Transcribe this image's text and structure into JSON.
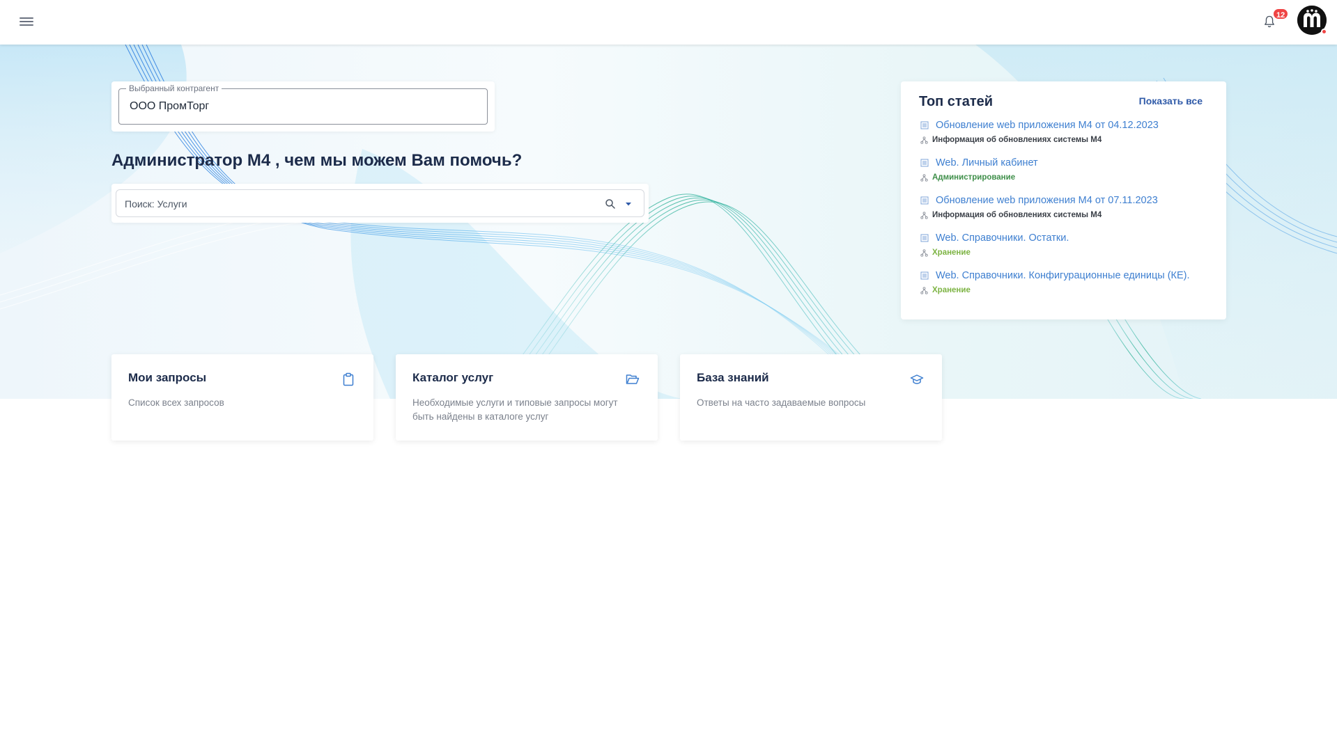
{
  "header": {
    "menu_icon": "hamburger-menu-icon",
    "notifications_icon": "bell-icon",
    "notifications_count": "12",
    "avatar_icon": "m4-logo-avatar"
  },
  "counterparty": {
    "label": "Выбранный контрагент",
    "value": "ООО ПромТорг"
  },
  "greeting": "Администратор М4 , чем мы можем Вам помочь?",
  "search": {
    "placeholder": "Поиск: Услуги",
    "search_icon": "search-icon",
    "dropdown_icon": "caret-down-icon"
  },
  "top_articles": {
    "title": "Топ статей",
    "show_all": "Показать все",
    "items": [
      {
        "title": "Обновление web приложения М4 от 04.12.2023",
        "category": "Информация об обновлениях системы М4",
        "category_color": "#3a3f47"
      },
      {
        "title": "Web. Личный кабинет",
        "category": "Администрирование",
        "category_color": "#3f8f4a"
      },
      {
        "title": "Обновление web приложения М4 от 07.11.2023",
        "category": "Информация об обновлениях системы М4",
        "category_color": "#3a3f47"
      },
      {
        "title": "Web. Справочники. Остатки.",
        "category": "Хранение",
        "category_color": "#7cb342"
      },
      {
        "title": "Web. Справочники. Конфигурационные единицы (КЕ).",
        "category": "Хранение",
        "category_color": "#7cb342"
      }
    ]
  },
  "features": [
    {
      "title": "Мои запросы",
      "description": "Список всех запросов",
      "icon": "clipboard-icon"
    },
    {
      "title": "Каталог услуг",
      "description": "Необходимые услуги и типовые запросы могут быть найдены в каталоге услуг",
      "icon": "folder-open-icon"
    },
    {
      "title": "База знаний",
      "description": "Ответы на часто задаваемые вопросы",
      "icon": "graduation-cap-icon"
    }
  ],
  "colors": {
    "accent": "#3e7fd0",
    "link_strong": "#2f5aa8",
    "heading": "#1c2b4a",
    "badge": "#ef4444"
  }
}
